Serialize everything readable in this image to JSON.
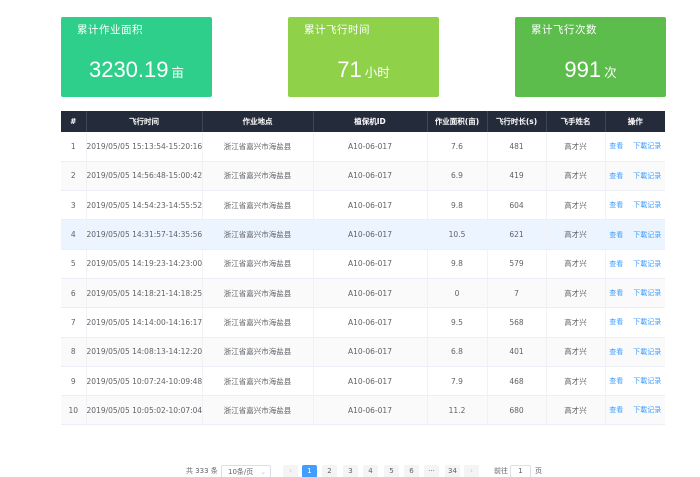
{
  "stats": [
    {
      "title": "累计作业面积",
      "value": "3230.19",
      "unit": "亩",
      "color": "#2ecf8a"
    },
    {
      "title": "累计飞行时间",
      "value": "71",
      "unit": "小时",
      "color": "#8fd24a"
    },
    {
      "title": "累计飞行次数",
      "value": "991",
      "unit": "次",
      "color": "#5cbc4c"
    }
  ],
  "table": {
    "columns": [
      "#",
      "飞行时间",
      "作业地点",
      "植保机ID",
      "作业面积(亩)",
      "飞行时长(s)",
      "飞手姓名",
      "操作"
    ],
    "rows": [
      {
        "no": "1",
        "time": "2019/05/05 15:13:54-15:20:16",
        "location": "浙江省嘉兴市海盐县",
        "device": "A10-06-017",
        "area": "7.6",
        "duration": "481",
        "pilot": "高才兴"
      },
      {
        "no": "2",
        "time": "2019/05/05 14:56:48-15:00:42",
        "location": "浙江省嘉兴市海盐县",
        "device": "A10-06-017",
        "area": "6.9",
        "duration": "419",
        "pilot": "高才兴"
      },
      {
        "no": "3",
        "time": "2019/05/05 14:54:23-14:55:52",
        "location": "浙江省嘉兴市海盐县",
        "device": "A10-06-017",
        "area": "9.8",
        "duration": "604",
        "pilot": "高才兴"
      },
      {
        "no": "4",
        "time": "2019/05/05 14:31:57-14:35:56",
        "location": "浙江省嘉兴市海盐县",
        "device": "A10-06-017",
        "area": "10.5",
        "duration": "621",
        "pilot": "高才兴"
      },
      {
        "no": "5",
        "time": "2019/05/05 14:19:23-14:23:00",
        "location": "浙江省嘉兴市海盐县",
        "device": "A10-06-017",
        "area": "9.8",
        "duration": "579",
        "pilot": "高才兴"
      },
      {
        "no": "6",
        "time": "2019/05/05 14:18:21-14:18:25",
        "location": "浙江省嘉兴市海盐县",
        "device": "A10-06-017",
        "area": "0",
        "duration": "7",
        "pilot": "高才兴"
      },
      {
        "no": "7",
        "time": "2019/05/05 14:14:00-14:16:17",
        "location": "浙江省嘉兴市海盐县",
        "device": "A10-06-017",
        "area": "9.5",
        "duration": "568",
        "pilot": "高才兴"
      },
      {
        "no": "8",
        "time": "2019/05/05 14:08:13-14:12:20",
        "location": "浙江省嘉兴市海盐县",
        "device": "A10-06-017",
        "area": "6.8",
        "duration": "401",
        "pilot": "高才兴"
      },
      {
        "no": "9",
        "time": "2019/05/05 10:07:24-10:09:48",
        "location": "浙江省嘉兴市海盐县",
        "device": "A10-06-017",
        "area": "7.9",
        "duration": "468",
        "pilot": "高才兴"
      },
      {
        "no": "10",
        "time": "2019/05/05 10:05:02-10:07:04",
        "location": "浙江省嘉兴市海盐县",
        "device": "A10-06-017",
        "area": "11.2",
        "duration": "680",
        "pilot": "高才兴"
      }
    ],
    "action_view": "查看",
    "action_download": "下載记录",
    "highlighted_row": 4
  },
  "pagination": {
    "total_text": "共 333 条",
    "page_size": "10条/页",
    "pages": [
      "1",
      "2",
      "3",
      "4",
      "5",
      "6",
      "···",
      "34"
    ],
    "current_page": "1",
    "prev_icon": "chevron-left-icon",
    "next_icon": "chevron-right-icon",
    "goto_label": "前往",
    "goto_value": "1",
    "goto_suffix": "页"
  }
}
